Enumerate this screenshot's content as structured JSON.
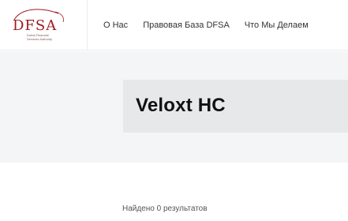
{
  "header": {
    "logo": {
      "text": "DFSA",
      "subtitle_lines": [
        "Dubai Financial",
        "Services Authority"
      ],
      "color": "#9c1b1f"
    },
    "nav": [
      {
        "label": "О Нас"
      },
      {
        "label": "Правовая База DFSA"
      },
      {
        "label": "Что Мы Делаем"
      }
    ]
  },
  "main": {
    "title": "Veloxt HC",
    "results_text": "Найдено 0 результатов"
  }
}
